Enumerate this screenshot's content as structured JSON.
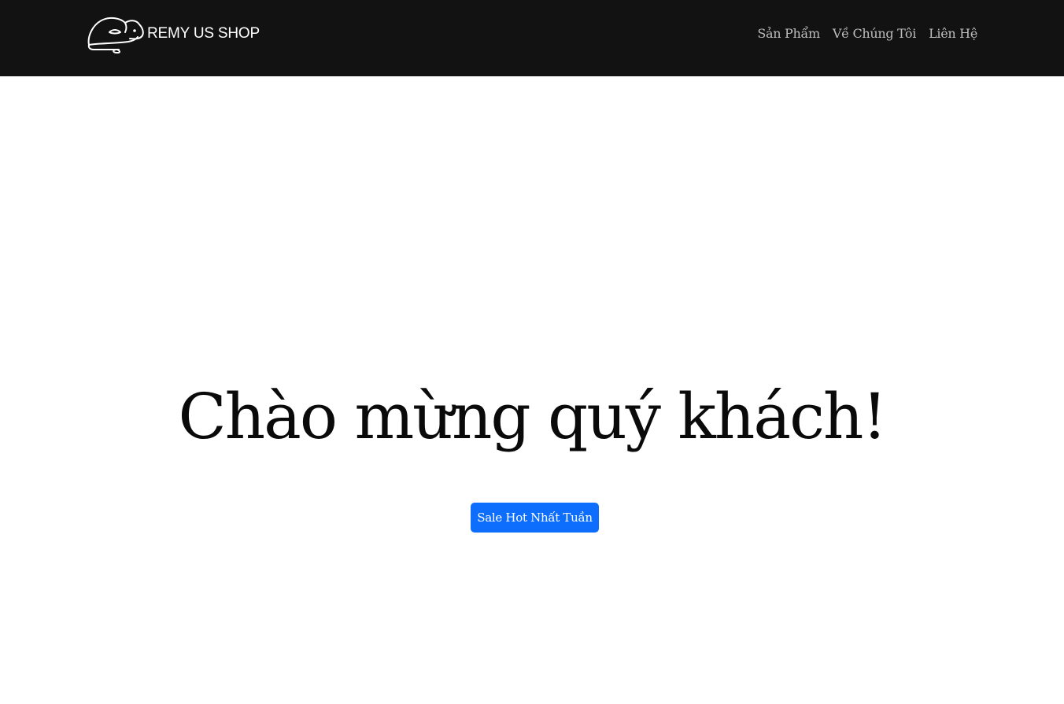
{
  "navbar": {
    "brand_name": "REMY US SHOP",
    "brand_icon": "mouse-logo-icon",
    "links": [
      {
        "label": "Sản Phẩm"
      },
      {
        "label": "Về Chúng Tôi"
      },
      {
        "label": "Liên Hệ"
      }
    ],
    "background_color": "#121212",
    "link_color": "#bdbdbd"
  },
  "hero": {
    "title": "Chào mừng quý khách!",
    "button_label": "Sale Hot Nhất Tuần",
    "button_color": "#0d6efd"
  }
}
